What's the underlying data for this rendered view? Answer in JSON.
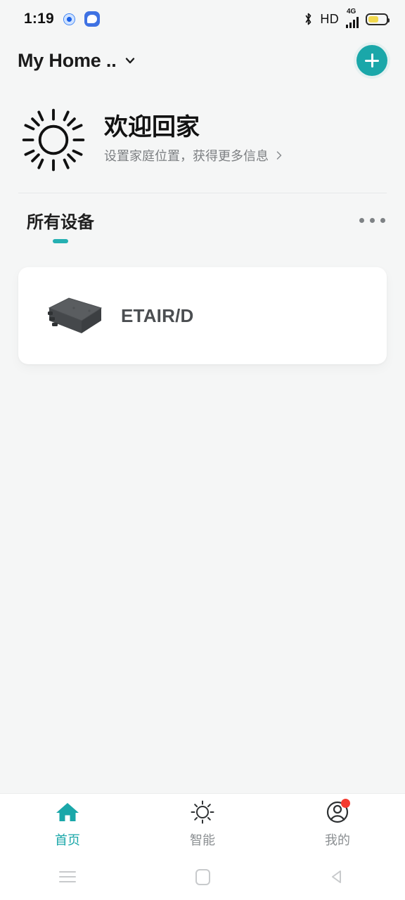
{
  "status_bar": {
    "time": "1:19",
    "left_icons": [
      "recording-dot-icon",
      "chat-bubble-icon"
    ],
    "bluetooth_icon": "bluetooth-icon",
    "hd_label": "HD",
    "network_label": "4G",
    "signal_bars": 4,
    "battery_level_pct": 60,
    "battery_color": "#f2d94e"
  },
  "app_bar": {
    "home_title": "My Home ..",
    "chevron_icon": "chevron-down-icon",
    "add_button_label": "+",
    "add_button_color": "#1aa7a9"
  },
  "welcome": {
    "icon": "sun-icon",
    "title": "欢迎回家",
    "subtitle": "设置家庭位置，获得更多信息",
    "chevron_icon": "chevron-right-icon"
  },
  "tabs": {
    "items": [
      {
        "label": "所有设备",
        "active": true
      }
    ],
    "overflow_icon": "more-horizontal-icon",
    "active_indicator_color": "#25b0b2"
  },
  "devices": [
    {
      "name": "ETAIR/D",
      "icon": "device-box-icon"
    }
  ],
  "bottom_nav": {
    "items": [
      {
        "label": "首页",
        "icon": "home-icon",
        "active": true,
        "badge": false
      },
      {
        "label": "智能",
        "icon": "sun-outline-icon",
        "active": false,
        "badge": false
      },
      {
        "label": "我的",
        "icon": "profile-icon",
        "active": false,
        "badge": true
      }
    ],
    "active_color": "#1aa7a9",
    "inactive_color": "#8b8f92"
  },
  "system_nav": {
    "recents_icon": "menu-icon",
    "home_icon": "square-icon",
    "back_icon": "triangle-left-icon"
  }
}
